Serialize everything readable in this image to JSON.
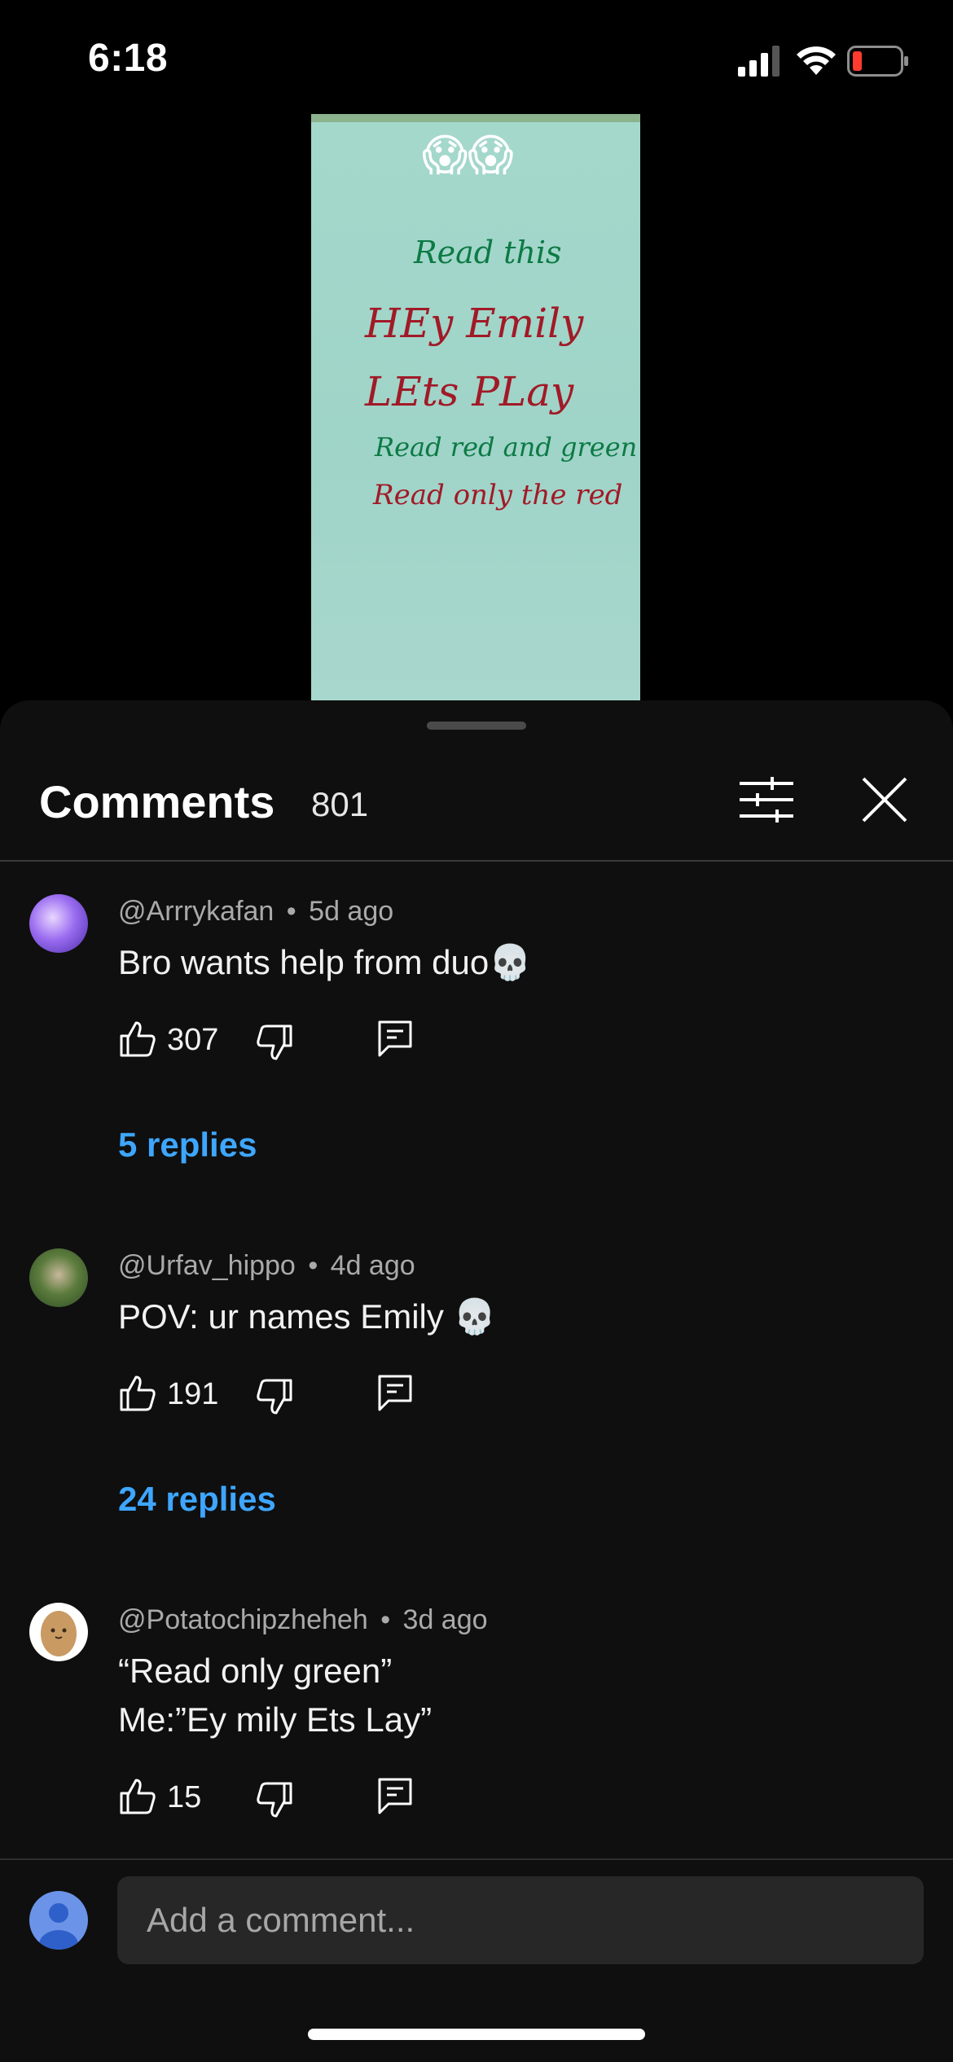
{
  "status_bar": {
    "time": "6:18",
    "signal": "cellular-signal-icon",
    "wifi": "wifi-icon",
    "battery": "battery-low-icon",
    "battery_color": "#ff3b30"
  },
  "video": {
    "emoji": "😱😱",
    "lines": [
      {
        "text": "Read this",
        "color": "green"
      },
      {
        "text": "HEy Emily",
        "color": "red"
      },
      {
        "text": "LEts PLay",
        "color": "red"
      },
      {
        "text": "Read red and green",
        "color": "green"
      },
      {
        "text": "Read only the red",
        "color": "red"
      }
    ]
  },
  "sheet": {
    "title": "Comments",
    "count": "801",
    "filter_icon": "sliders-icon",
    "close_icon": "close-icon"
  },
  "comments": [
    {
      "author": "@Arrrykafan",
      "age": "5d ago",
      "text_lines": [
        "Bro wants help from duo💀"
      ],
      "likes": "307",
      "replies": "5 replies"
    },
    {
      "author": "@Urfav_hippo",
      "age": "4d ago",
      "text_lines": [
        "POV: ur names Emily 💀"
      ],
      "likes": "191",
      "replies": "24 replies"
    },
    {
      "author": "@Potatochipzheheh",
      "age": "3d ago",
      "text_lines": [
        "“Read only green”",
        "Me:”Ey mily Ets Lay”"
      ],
      "likes": "15"
    }
  ],
  "composer": {
    "placeholder": "Add a comment..."
  },
  "colors": {
    "accent_link": "#3ea6ff",
    "sheet_bg": "#0f0f0f",
    "input_bg": "#272727"
  },
  "separator": "•"
}
